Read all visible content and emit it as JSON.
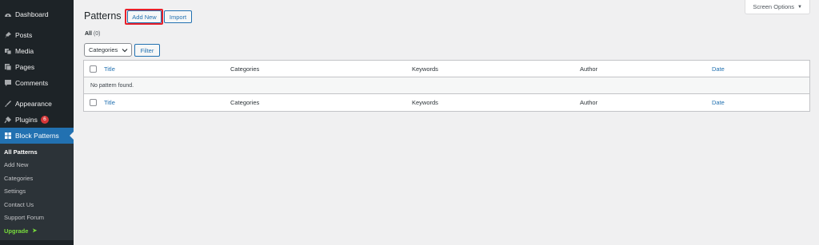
{
  "sidebar": {
    "items": [
      {
        "label": "Dashboard",
        "icon": "dashboard-icon"
      },
      {
        "label": "Posts",
        "icon": "pin-icon"
      },
      {
        "label": "Media",
        "icon": "media-icon"
      },
      {
        "label": "Pages",
        "icon": "pages-icon"
      },
      {
        "label": "Comments",
        "icon": "comment-icon"
      },
      {
        "label": "Appearance",
        "icon": "brush-icon"
      },
      {
        "label": "Plugins",
        "icon": "plugin-icon",
        "badge": "6"
      },
      {
        "label": "Block Patterns",
        "icon": "blocks-icon"
      }
    ],
    "submenu": [
      {
        "label": "All Patterns"
      },
      {
        "label": "Add New"
      },
      {
        "label": "Categories"
      },
      {
        "label": "Settings"
      },
      {
        "label": "Contact Us"
      },
      {
        "label": "Support Forum"
      },
      {
        "label": "Upgrade",
        "icon": "arrow-right-icon",
        "arrow": "➤"
      }
    ]
  },
  "header": {
    "screen_options": "Screen Options",
    "caret": "▼",
    "title": "Patterns",
    "add_new": "Add New",
    "import": "Import"
  },
  "views": {
    "all_label": "All",
    "all_count": "(0)"
  },
  "filters": {
    "category_select": "Categories",
    "filter_button": "Filter"
  },
  "table": {
    "columns": [
      "Title",
      "Categories",
      "Keywords",
      "Author",
      "Date"
    ],
    "empty_message": "No pattern found."
  },
  "colors": {
    "accent": "#2271b1",
    "sidebar_bg": "#1d2327",
    "highlight_outline": "#e8202a",
    "badge": "#d63638",
    "upgrade": "#78dc3c"
  }
}
